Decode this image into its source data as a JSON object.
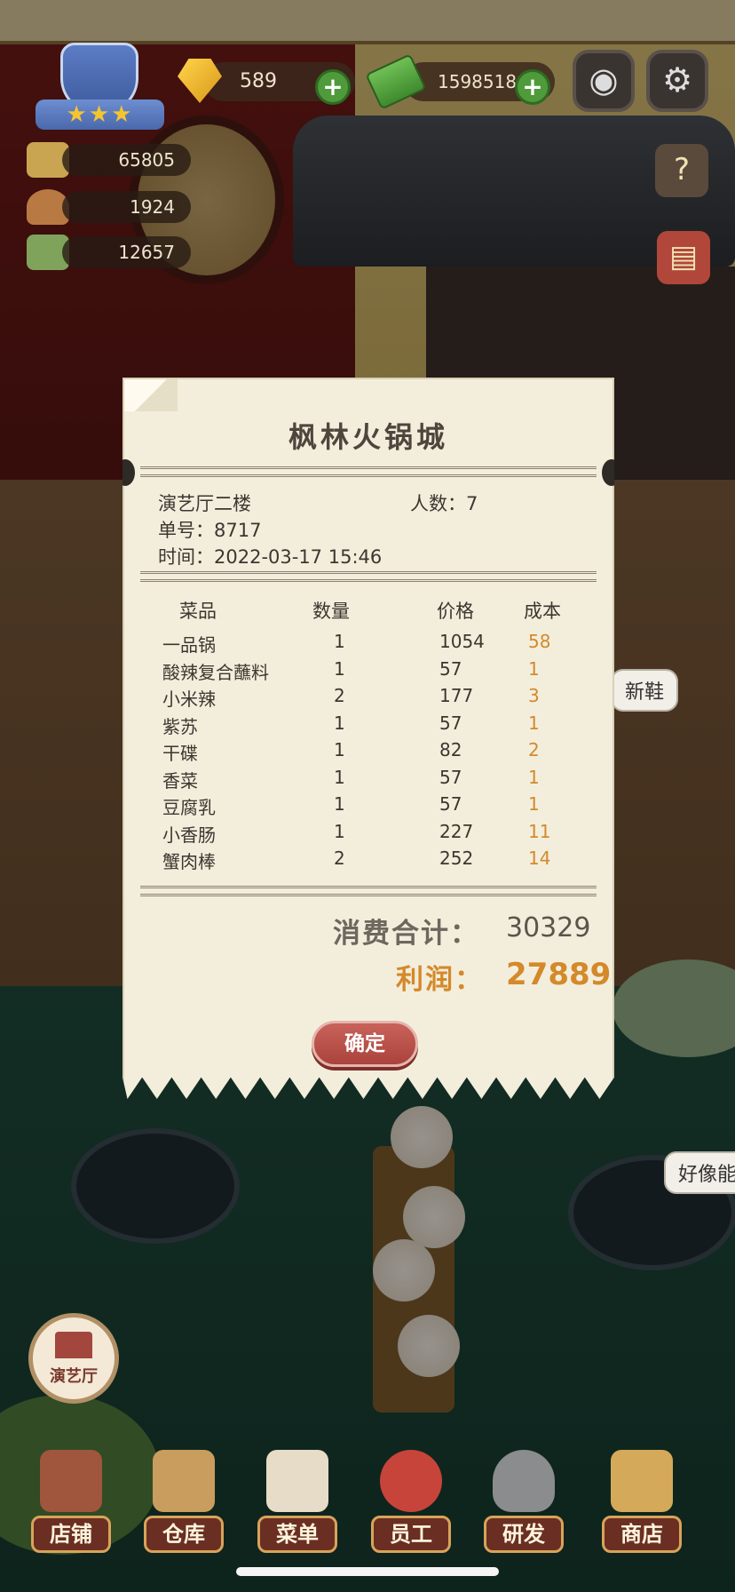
{
  "hud": {
    "gems": "589",
    "cash": "1598518",
    "stats": [
      "65805",
      "1924",
      "12657"
    ],
    "stars": "★★★",
    "camera_icon": "camera-icon",
    "settings_icon": "gear-icon",
    "help_icon": "help-book-icon",
    "recipe_icon": "recipe-book-icon"
  },
  "scene": {
    "speech_new_shoes": "新鞋",
    "speech_seems": "好像能"
  },
  "receipt": {
    "title": "枫林火锅城",
    "location": "演艺厅二楼",
    "guests": "人数：7",
    "order_no": "单号：8717",
    "time": "时间：2022-03-17 15:46",
    "headers": {
      "dish": "菜品",
      "qty": "数量",
      "price": "价格",
      "cost": "成本"
    },
    "items": [
      {
        "name": "一品锅",
        "qty": "1",
        "price": "1054",
        "cost": "58"
      },
      {
        "name": "酸辣复合蘸料",
        "qty": "1",
        "price": "57",
        "cost": "1"
      },
      {
        "name": "小米辣",
        "qty": "2",
        "price": "177",
        "cost": "3"
      },
      {
        "name": "紫苏",
        "qty": "1",
        "price": "57",
        "cost": "1"
      },
      {
        "name": "干碟",
        "qty": "1",
        "price": "82",
        "cost": "2"
      },
      {
        "name": "香菜",
        "qty": "1",
        "price": "57",
        "cost": "1"
      },
      {
        "name": "豆腐乳",
        "qty": "1",
        "price": "57",
        "cost": "1"
      },
      {
        "name": "小香肠",
        "qty": "1",
        "price": "227",
        "cost": "11"
      },
      {
        "name": "蟹肉棒",
        "qty": "2",
        "price": "252",
        "cost": "14"
      }
    ],
    "total_label": "消费合计：",
    "total_value": "30329",
    "profit_label": "利润：",
    "profit_value": "27889",
    "confirm": "确定"
  },
  "venue_button": "演艺厅",
  "nav": [
    {
      "label": "店铺",
      "icon": "shop-building-icon"
    },
    {
      "label": "仓库",
      "icon": "warehouse-boxes-icon"
    },
    {
      "label": "菜单",
      "icon": "menu-clipboard-icon"
    },
    {
      "label": "员工",
      "icon": "staff-chef-icon"
    },
    {
      "label": "研发",
      "icon": "research-wok-icon"
    },
    {
      "label": "商店",
      "icon": "store-stall-icon"
    }
  ],
  "colors": {
    "accent_orange": "#d4892a",
    "confirm_red": "#b84d45",
    "paper": "#f3eedc"
  }
}
